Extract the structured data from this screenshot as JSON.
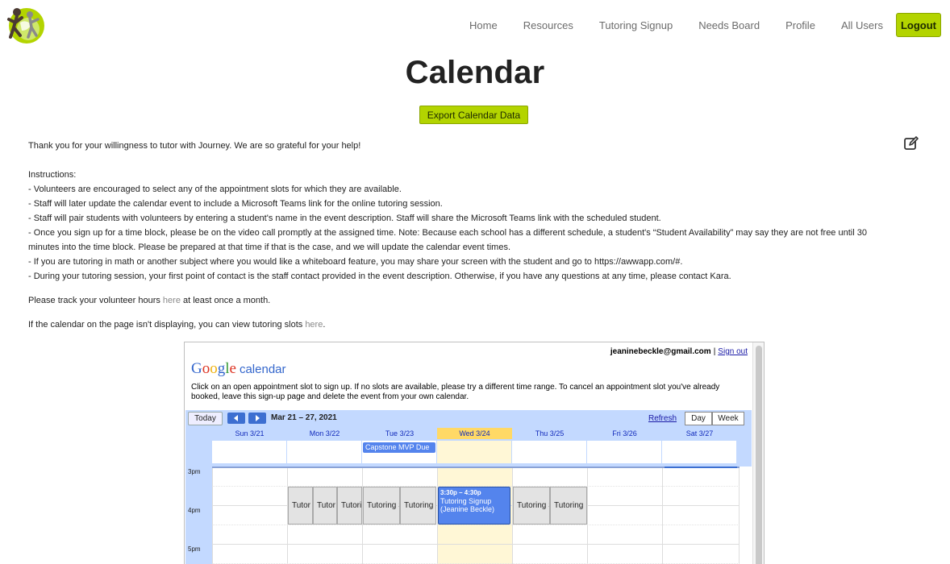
{
  "nav": {
    "logo_alt": "Journey logo",
    "links": [
      "Home",
      "Resources",
      "Tutoring Signup",
      "Needs Board",
      "Profile",
      "All Users"
    ],
    "logout": "Logout"
  },
  "page": {
    "title": "Calendar",
    "export_button": "Export Calendar Data"
  },
  "content": {
    "thanks": "Thank you for your willingness to tutor with Journey. We are so grateful for your help!",
    "instructions_heading": "Instructions:",
    "instructions": [
      "- Volunteers are encouraged to select any of the appointment slots for which they are available.",
      "- Staff will later update the calendar event to include a Microsoft Teams link for the online tutoring session.",
      "- Staff will pair students with volunteers by entering a student's name in the event description. Staff will share the Microsoft Teams link with the scheduled student.",
      "- Once you sign up for a time block, please be on the video call promptly at the assigned time. Note: Because each school has a different schedule, a student's “Student Availability” may say they are not free until 30 minutes into the time block. Please be prepared at that time if that is the case, and we will update the calendar event times.",
      "- If you are tutoring in math or another subject where you would like a whiteboard feature, you may share your screen with the student and go to https://awwapp.com/#.",
      "- During your tutoring session, your first point of contact is the staff contact provided in the event description. Otherwise, if you have any questions at any time, please contact Kara."
    ],
    "hours_prefix": "Please track your volunteer hours ",
    "hours_link": "here",
    "hours_suffix": " at least once a month.",
    "calendar_prefix": "If the calendar on the page isn't displaying, you can view tutoring slots ",
    "calendar_link": "here",
    "calendar_suffix": "."
  },
  "gcal": {
    "user_email": "jeaninebeckle@gmail.com",
    "separator": "|",
    "sign_out": "Sign out",
    "logo_letters": [
      "G",
      "o",
      "o",
      "g",
      "l",
      "e"
    ],
    "logo_word": "calendar",
    "instructions": "Click on an open appointment slot to sign up. If no slots are available, please try a different time range. To cancel an appointment slot you've already booked, leave this sign-up page and delete the event from your own calendar.",
    "today_button": "Today",
    "date_range": "Mar 21 – 27, 2021",
    "refresh": "Refresh",
    "view_day": "Day",
    "view_week": "Week",
    "days": [
      "Sun 3/21",
      "Mon 3/22",
      "Tue 3/23",
      "Wed 3/24",
      "Thu 3/25",
      "Fri 3/26",
      "Sat 3/27"
    ],
    "today_index": 3,
    "allday_event": "Capstone MVP Due",
    "times": [
      "3pm",
      "4pm",
      "5pm"
    ],
    "slots": {
      "mon_1": "Tutor",
      "mon_2": "Tutor",
      "mon_3": "Tutorir",
      "tue_1": "Tutoring S",
      "tue_2": "Tutoring",
      "thu_1": "Tutoring S",
      "thu_2": "Tutoring"
    },
    "booked": {
      "time": "3:30p – 4:30p",
      "title": "Tutoring Signup (Jeanine Beckle)"
    }
  }
}
